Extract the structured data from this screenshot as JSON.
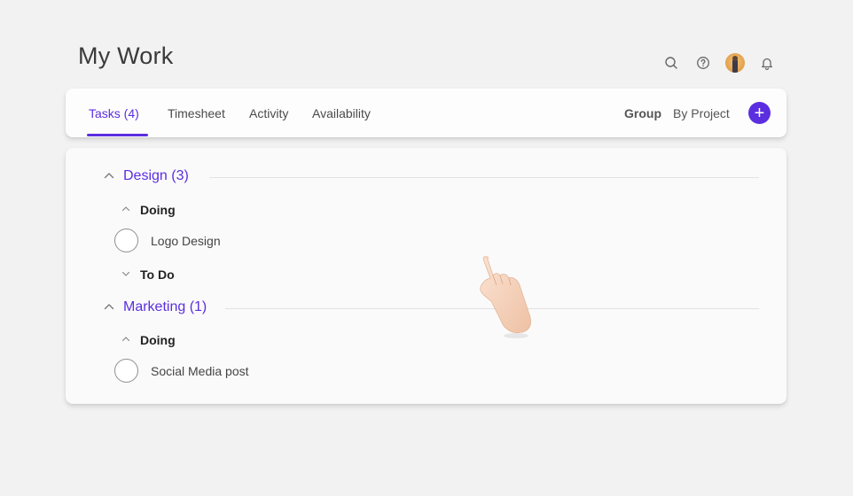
{
  "page": {
    "title": "My Work"
  },
  "header_icons": [
    {
      "name": "search-icon"
    },
    {
      "name": "help-icon"
    },
    {
      "name": "avatar"
    },
    {
      "name": "bell-icon"
    }
  ],
  "tabs": [
    {
      "label": "Tasks (4)",
      "active": true
    },
    {
      "label": "Timesheet",
      "active": false
    },
    {
      "label": "Activity",
      "active": false
    },
    {
      "label": "Availability",
      "active": false
    }
  ],
  "toolbar": {
    "group_label": "Group",
    "group_value": "By Project",
    "add_label": "+"
  },
  "groups": [
    {
      "title": "Design (3)",
      "sections": [
        {
          "status": "Doing",
          "expanded": true,
          "tasks": [
            "Logo Design"
          ]
        },
        {
          "status": "To Do",
          "expanded": false,
          "tasks": []
        }
      ]
    },
    {
      "title": "Marketing (1)",
      "sections": [
        {
          "status": "Doing",
          "expanded": true,
          "tasks": [
            "Social Media post"
          ]
        }
      ]
    }
  ],
  "colors": {
    "accent": "#5b2ee0",
    "background": "#f2f2f2",
    "card": "#fafafa"
  }
}
